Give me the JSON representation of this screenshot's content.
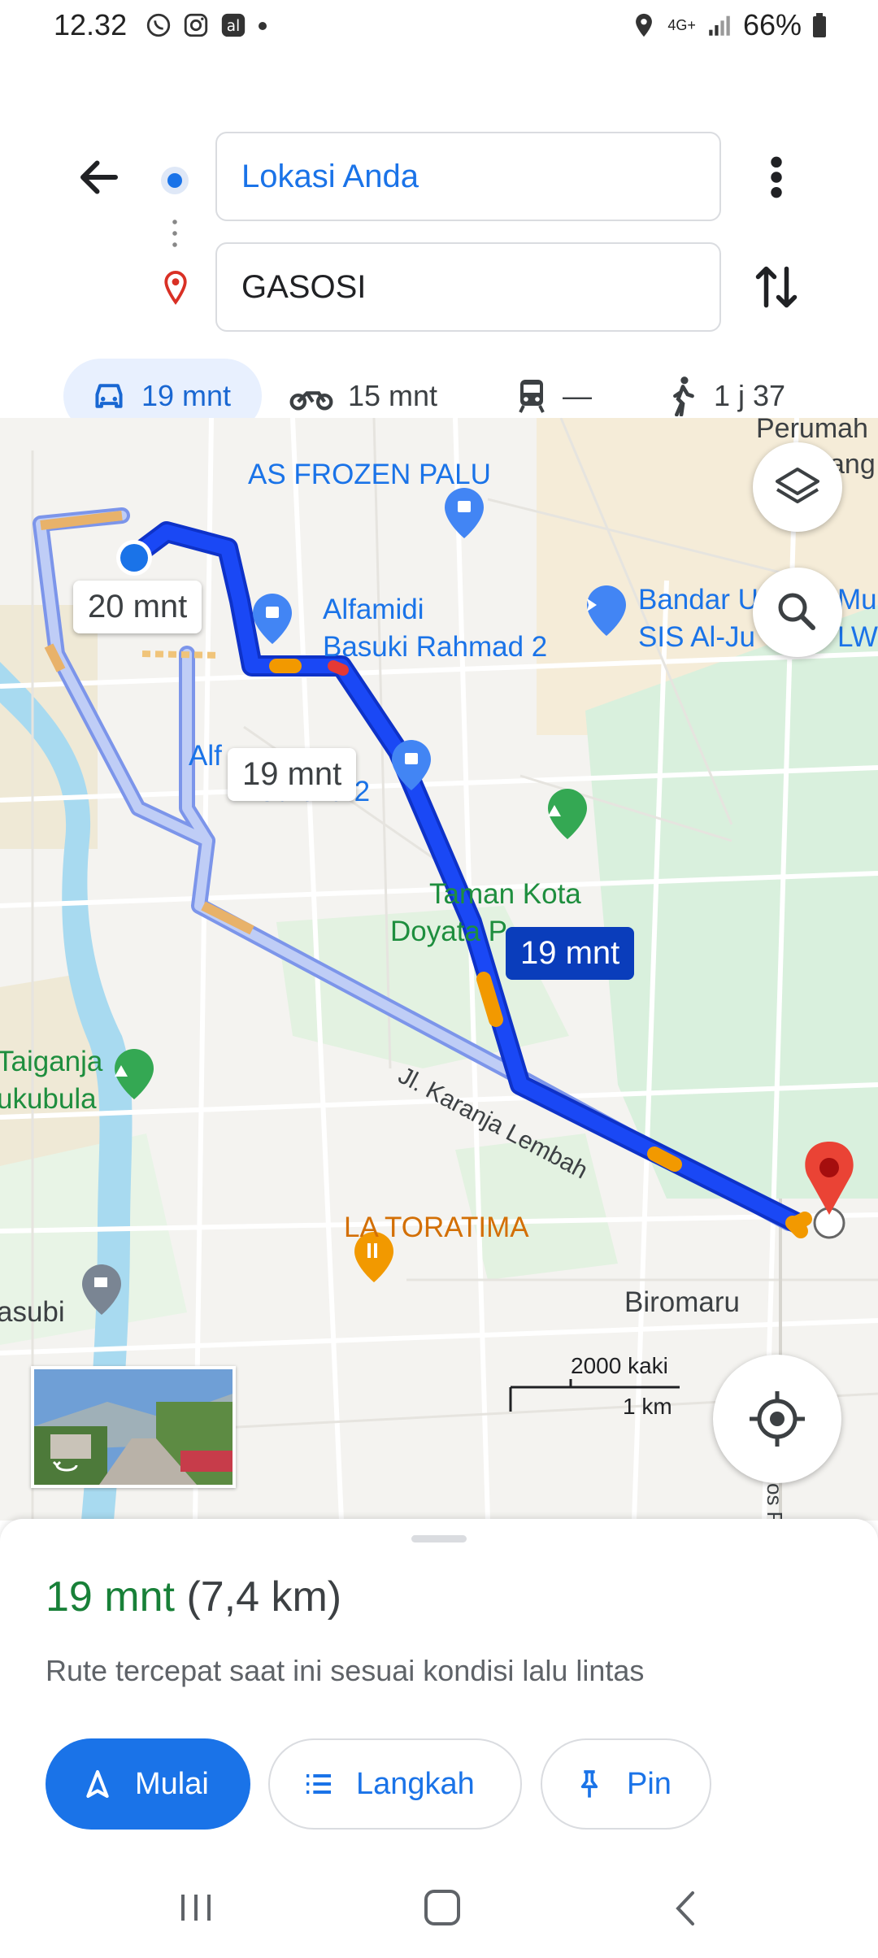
{
  "status_bar": {
    "time": "12.32",
    "network": "4G+",
    "battery": "66%"
  },
  "directions": {
    "origin": "Lokasi Anda",
    "destination": "GASOSI"
  },
  "modes": [
    {
      "mode": "car",
      "label": "19 mnt",
      "active": true
    },
    {
      "mode": "motorcycle",
      "label": "15 mnt",
      "active": false
    },
    {
      "mode": "transit",
      "label": "—",
      "active": false
    },
    {
      "mode": "walk",
      "label": "1 j 37",
      "active": false
    }
  ],
  "map": {
    "places": {
      "as_frozen": "AS FROZEN PALU",
      "perumahan": "Perumah",
      "perumahan2": "ang",
      "alfamidi_1": "Alfamidi",
      "alfamidi_2": "Basuki Rahmad 2",
      "alf_short": "Alf",
      "cartika": "Cartika 2",
      "bandar_1": "Bandar U",
      "bandar_2": "SIS Al-Ju",
      "bandar_3": "Mu",
      "bandar_4": "LW",
      "taman_1": "Taman Kota",
      "taman_2": "Doyata P",
      "taiganja_1": "Taiganja",
      "taiganja_2": "ukubula",
      "road": "Jl. Karanja Lembah",
      "la_toratima": "LA TORATIMA",
      "biromaru": "Biromaru",
      "asubi": "asubi",
      "road_vertical": "os P"
    },
    "route_bubbles": {
      "alt1": "20 mnt",
      "alt2": "19 mnt",
      "selected": "19 mnt"
    },
    "scale": {
      "imperial": "2000 kaki",
      "metric": "1 km"
    }
  },
  "sheet": {
    "duration": "19 mnt",
    "distance": "(7,4 km)",
    "subtitle": "Rute tercepat saat ini sesuai kondisi lalu lintas",
    "buttons": {
      "start": "Mulai",
      "steps": "Langkah",
      "pin": "Pin"
    }
  },
  "colors": {
    "accent": "#1a73e8",
    "route": "#1a3cf0",
    "route_alt": "#a9bdf5",
    "traffic": "#f29900",
    "duration_green": "#188038"
  }
}
